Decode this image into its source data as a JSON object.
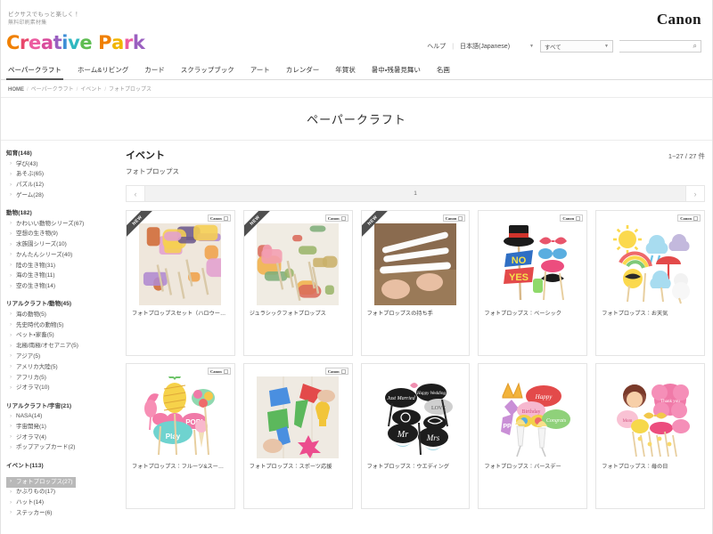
{
  "header": {
    "tagline_line1": "ピクサスでもっと楽しく！",
    "tagline_line2": "無料印刷素材集",
    "brand": "Canon",
    "logo_text": "Creative Park",
    "logo_colors": [
      "#f08000",
      "#e8486c",
      "#ec5ba0",
      "#d94b9c",
      "#9a5fc0",
      "#3f8fd6",
      "#2fb8c0",
      "#5fbd52",
      "#f08000",
      "#f0b500",
      "#ec5ba0",
      "#9a5fc0"
    ],
    "help_label": "ヘルプ",
    "divider": "|",
    "language_label": "日本語(Japanese)",
    "search_scope": "すべて",
    "search_placeholder": "",
    "search_value": "",
    "caret_glyph": "▼",
    "search_icon_glyph": "⌕"
  },
  "nav": {
    "items": [
      {
        "label": "ペーパークラフト",
        "active": true
      },
      {
        "label": "ホーム&リビング",
        "active": false
      },
      {
        "label": "カード",
        "active": false
      },
      {
        "label": "スクラップブック",
        "active": false
      },
      {
        "label": "アート",
        "active": false
      },
      {
        "label": "カレンダー",
        "active": false
      },
      {
        "label": "年賀状",
        "active": false
      },
      {
        "label": "暑中・残暑見舞い",
        "active": false
      },
      {
        "label": "名画",
        "active": false
      }
    ]
  },
  "breadcrumb": {
    "home": "HOME",
    "items": [
      "ペーパークラフト",
      "イベント",
      "フォトプロップス"
    ],
    "separator": "/"
  },
  "page_title": "ペーパークラフト",
  "sidebar": {
    "groups": [
      {
        "heading": "知育(148)",
        "items": [
          {
            "label": "学び(43)",
            "selected": false
          },
          {
            "label": "あそぶ(65)",
            "selected": false
          },
          {
            "label": "パズル(12)",
            "selected": false
          },
          {
            "label": "ゲーム(28)",
            "selected": false
          }
        ]
      },
      {
        "heading": "動物(182)",
        "items": [
          {
            "label": "かわいい動物シリーズ(67)",
            "selected": false
          },
          {
            "label": "空想の生き物(9)",
            "selected": false
          },
          {
            "label": "水族園シリーズ(10)",
            "selected": false
          },
          {
            "label": "かんたんシリーズ(40)",
            "selected": false
          },
          {
            "label": "陸の生き物(31)",
            "selected": false
          },
          {
            "label": "海の生き物(11)",
            "selected": false
          },
          {
            "label": "空の生き物(14)",
            "selected": false
          }
        ]
      },
      {
        "heading": "リアルクラフト/動物(45)",
        "items": [
          {
            "label": "海の動物(5)",
            "selected": false
          },
          {
            "label": "先史時代の動物(5)",
            "selected": false
          },
          {
            "label": "ペット・家畜(5)",
            "selected": false
          },
          {
            "label": "北極/南極/オセアニア(5)",
            "selected": false
          },
          {
            "label": "アジア(5)",
            "selected": false
          },
          {
            "label": "アメリカ大陸(5)",
            "selected": false
          },
          {
            "label": "アフリカ(5)",
            "selected": false
          },
          {
            "label": "ジオラマ(10)",
            "selected": false
          }
        ]
      },
      {
        "heading": "リアルクラフト/宇宙(21)",
        "items": [
          {
            "label": "NASA(14)",
            "selected": false
          },
          {
            "label": "宇宙開発(1)",
            "selected": false
          },
          {
            "label": "ジオラマ(4)",
            "selected": false
          },
          {
            "label": "ポップアップカード(2)",
            "selected": false
          }
        ]
      },
      {
        "heading": "イベント(113)",
        "items": [
          {
            "label": "フォトプロップス(27)",
            "selected": true
          },
          {
            "label": "かぶりもの(17)",
            "selected": false
          },
          {
            "label": "ハット(14)",
            "selected": false
          },
          {
            "label": "ステッカー(6)",
            "selected": false
          }
        ]
      }
    ]
  },
  "main": {
    "title": "イベント",
    "subtitle": "フォトプロップス",
    "count_text": "1~27 / 27 件",
    "pager": {
      "prev_glyph": "‹",
      "next_glyph": "›",
      "current_page": "1"
    },
    "card_badge": {
      "text": "Canon",
      "mark": ""
    },
    "new_badge": "NEW",
    "cards": [
      {
        "label": "フォトプロップスセット（ハロウー…",
        "is_new": true,
        "has_badge": true,
        "thumb": "halloween-props-photo"
      },
      {
        "label": "ジュラシックフォトプロップス",
        "is_new": true,
        "has_badge": true,
        "thumb": "jurassic-props-photo"
      },
      {
        "label": "フォトプロップスの持ち手",
        "is_new": true,
        "has_badge": true,
        "thumb": "handle-sticks-photo"
      },
      {
        "label": "フォトプロップス：ベーシック",
        "is_new": false,
        "has_badge": true,
        "thumb": "basic-props-illust"
      },
      {
        "label": "フォトプロップス：お天気",
        "is_new": false,
        "has_badge": true,
        "thumb": "weather-props-illust"
      },
      {
        "label": "フォトプロップス：フルーツ&スー…",
        "is_new": false,
        "has_badge": true,
        "thumb": "fruit-props-illust"
      },
      {
        "label": "フォトプロップス：スポーツ応援",
        "is_new": false,
        "has_badge": true,
        "thumb": "sports-props-photo"
      },
      {
        "label": "フォトプロップス：ウエディング",
        "is_new": false,
        "has_badge": false,
        "thumb": "wedding-props-illust"
      },
      {
        "label": "フォトプロップス：バースデー",
        "is_new": false,
        "has_badge": false,
        "thumb": "birthday-props-illust"
      },
      {
        "label": "フォトプロップス：母の日",
        "is_new": false,
        "has_badge": false,
        "thumb": "mothersday-props-illust"
      }
    ]
  }
}
